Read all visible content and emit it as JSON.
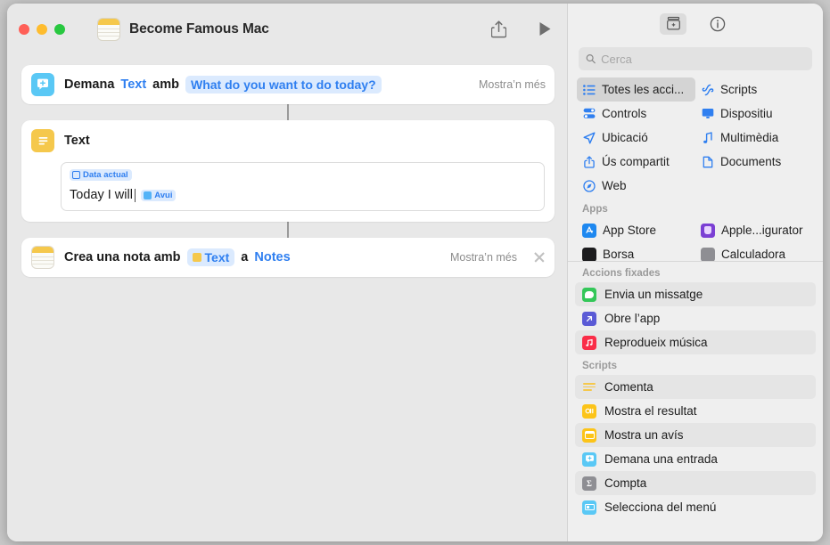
{
  "window": {
    "title": "Become Famous Mac",
    "traffic_lights": [
      "close",
      "minimize",
      "zoom"
    ],
    "toolbar": {
      "share_label": "share-icon",
      "run_label": "play-icon"
    }
  },
  "editor": {
    "actions": [
      {
        "icon": "ask-input-icon",
        "icon_color": "#5ac8f5",
        "parts": [
          {
            "type": "plain",
            "text": "Demana"
          },
          {
            "type": "link",
            "text": "Text"
          },
          {
            "type": "plain",
            "text": "amb"
          },
          {
            "type": "token",
            "text": "What do you want to do today?"
          }
        ],
        "show_more": "Mostra’n més",
        "has_close": false
      },
      {
        "icon": "text-icon",
        "icon_color": "#f5c84c",
        "title": "Text",
        "field": {
          "chip_top": "Data actual",
          "line_text": "Today I will",
          "chip_inline": "Avui"
        }
      },
      {
        "icon": "notes-icon",
        "icon_color": "#f5c84c",
        "parts": [
          {
            "type": "plain",
            "text": "Crea una nota amb"
          },
          {
            "type": "token_icon",
            "text": "Text"
          },
          {
            "type": "plain",
            "text": "a"
          },
          {
            "type": "link",
            "text": "Notes"
          }
        ],
        "show_more": "Mostra’n més",
        "has_close": true
      }
    ]
  },
  "sidebar": {
    "toolbar": {
      "library_label": "action-library-icon",
      "info_label": "info-icon"
    },
    "search": {
      "placeholder": "Cerca",
      "value": "",
      "icon": "search-icon"
    },
    "categories": [
      {
        "label": "Totes les acci...",
        "icon": "list-icon",
        "color": "#2f7ff0",
        "selected": true
      },
      {
        "label": "Scripts",
        "icon": "scripts-icon",
        "color": "#2f7ff0",
        "selected": false
      },
      {
        "label": "Controls",
        "icon": "controls-icon",
        "color": "#2f7ff0",
        "selected": false
      },
      {
        "label": "Dispositiu",
        "icon": "display-icon",
        "color": "#2f7ff0",
        "selected": false
      },
      {
        "label": "Ubicació",
        "icon": "location-arrow-icon",
        "color": "#2f7ff0",
        "selected": false
      },
      {
        "label": "Multimèdia",
        "icon": "music-note-icon",
        "color": "#2f7ff0",
        "selected": false
      },
      {
        "label": "Ús compartit",
        "icon": "share-icon",
        "color": "#2f7ff0",
        "selected": false
      },
      {
        "label": "Documents",
        "icon": "document-icon",
        "color": "#2f7ff0",
        "selected": false
      },
      {
        "label": "Web",
        "icon": "compass-icon",
        "color": "#2f7ff0",
        "selected": false
      }
    ],
    "apps_header": "Apps",
    "apps": [
      {
        "label": "App Store",
        "color": "#1e88f0"
      },
      {
        "label": "Apple...igurator",
        "color": "#7b3fd4"
      },
      {
        "label": "Borsa",
        "color": "#1c1c1e"
      },
      {
        "label": "Calculadora",
        "color": "#8e8e93"
      }
    ],
    "pinned_header": "Accions fixades",
    "pinned": [
      {
        "label": "Envia un missatge",
        "color": "#34c759",
        "icon": "messages-icon"
      },
      {
        "label": "Obre l’app",
        "color": "#5b5bd6",
        "icon": "open-app-icon"
      },
      {
        "label": "Reprodueix música",
        "color": "#fa2d48",
        "icon": "music-icon"
      }
    ],
    "scripts_header": "Scripts",
    "scripts": [
      {
        "label": "Comenta",
        "color": "#f5c84c",
        "icon": "comment-icon"
      },
      {
        "label": "Mostra el resultat",
        "color": "#fcc419",
        "icon": "quick-look-icon"
      },
      {
        "label": "Mostra un avís",
        "color": "#fcc419",
        "icon": "alert-icon"
      },
      {
        "label": "Demana una entrada",
        "color": "#5ac8f5",
        "icon": "ask-input-icon"
      },
      {
        "label": "Compta",
        "color": "#8e8e93",
        "icon": "count-icon"
      },
      {
        "label": "Selecciona del menú",
        "color": "#5ac8f5",
        "icon": "menu-icon"
      }
    ]
  }
}
